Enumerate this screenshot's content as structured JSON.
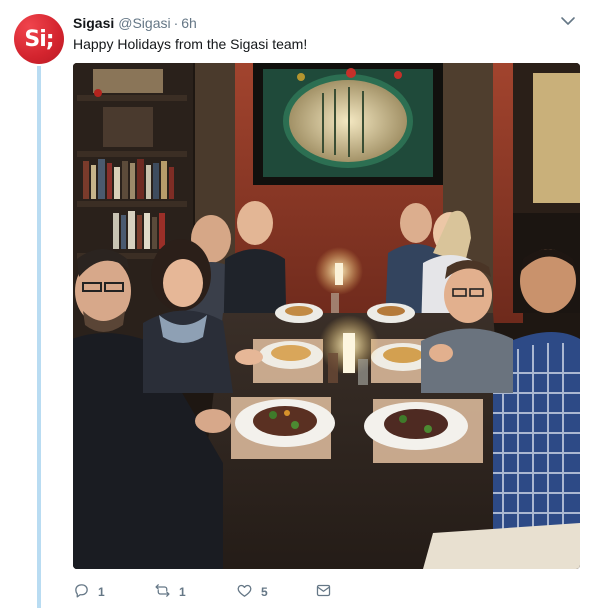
{
  "tweet": {
    "display_name": "Sigasi",
    "handle": "@Sigasi",
    "separator": "·",
    "time": "6h",
    "text": "Happy Holidays from the Sigasi team!",
    "avatar_text": "Si;"
  },
  "actions": {
    "reply_count": "1",
    "retweet_count": "1",
    "like_count": "5"
  },
  "colors": {
    "brand_red": "#d3242e",
    "thread_line": "#b9dcf2",
    "muted": "#657786"
  },
  "icons": [
    "chevron-down-icon",
    "reply-icon",
    "retweet-icon",
    "like-icon",
    "direct-message-icon"
  ]
}
